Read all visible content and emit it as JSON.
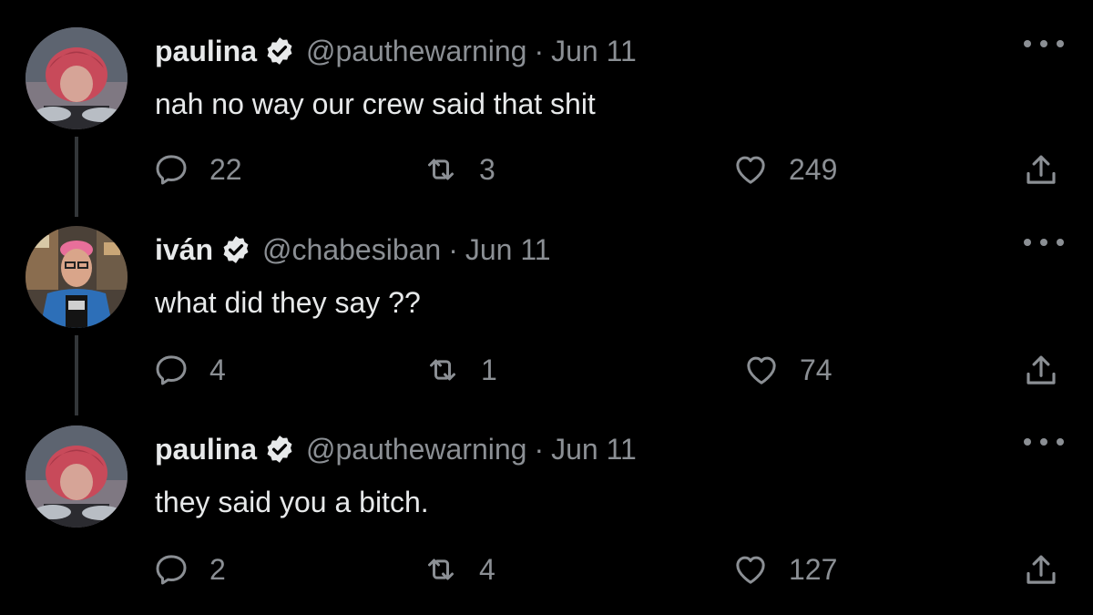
{
  "tweets": [
    {
      "name": "paulina",
      "handle": "@pauthewarning",
      "separator": "·",
      "date": "Jun 11",
      "text": "nah no way our crew said that shit",
      "replies": "22",
      "retweets": "3",
      "likes": "249",
      "avatar_hair_color": "#c84a5a"
    },
    {
      "name": "iván",
      "handle": "@chabesiban",
      "separator": "·",
      "date": "Jun 11",
      "text": "what did they say ??",
      "replies": "4",
      "retweets": "1",
      "likes": "74",
      "avatar_hair_color": "#e86f9a"
    },
    {
      "name": "paulina",
      "handle": "@pauthewarning",
      "separator": "·",
      "date": "Jun 11",
      "text": "they said you a bitch.",
      "replies": "2",
      "retweets": "4",
      "likes": "127",
      "avatar_hair_color": "#c84a5a"
    }
  ],
  "icons": {
    "verified": "verified-badge-icon",
    "reply": "reply-icon",
    "retweet": "retweet-icon",
    "like": "heart-icon",
    "share": "share-icon",
    "more": "more-icon"
  },
  "colors": {
    "background": "#000000",
    "text": "#e7e9ea",
    "muted": "#8b8f94",
    "thread_line": "#333639"
  }
}
